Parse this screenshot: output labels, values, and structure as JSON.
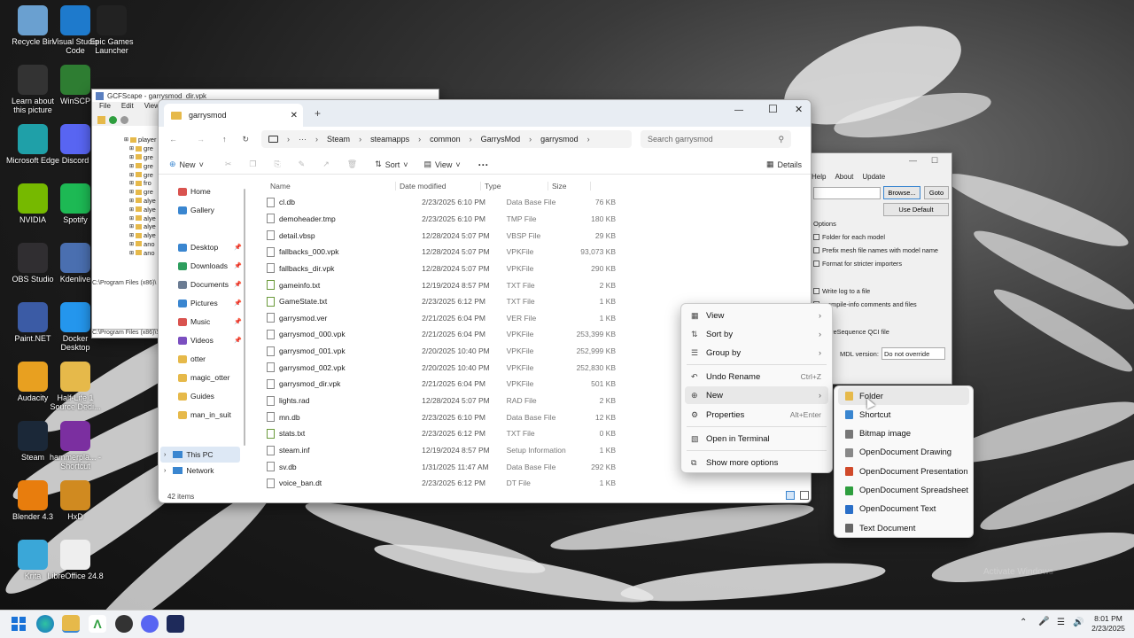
{
  "desktop_icons": [
    {
      "label": "Recycle Bin",
      "icon": "recycle-bin-icon",
      "color": "#6aa0d0"
    },
    {
      "label": "Visual Studio Code",
      "icon": "vscode-icon",
      "color": "#1e7acc"
    },
    {
      "label": "Epic Games Launcher",
      "icon": "epic-games-icon",
      "color": "#222"
    },
    {
      "label": "Learn about this picture",
      "icon": "learn-picture-icon",
      "color": "#333"
    },
    {
      "label": "WinSCP",
      "icon": "winscp-icon",
      "color": "#2e7d32"
    },
    {
      "label": "Microsoft Edge",
      "icon": "edge-icon",
      "color": "#1fa0a8"
    },
    {
      "label": "Discord",
      "icon": "discord-icon",
      "color": "#5865f2"
    },
    {
      "label": "NVIDIA",
      "icon": "nvidia-icon",
      "color": "#76b900"
    },
    {
      "label": "Spotify",
      "icon": "spotify-icon",
      "color": "#1db954"
    },
    {
      "label": "OBS Studio",
      "icon": "obs-icon",
      "color": "#302e31"
    },
    {
      "label": "Kdenlive",
      "icon": "kdenlive-icon",
      "color": "#4a6fb0"
    },
    {
      "label": "Paint.NET",
      "icon": "paintnet-icon",
      "color": "#3b5ba5"
    },
    {
      "label": "Docker Desktop",
      "icon": "docker-icon",
      "color": "#2496ed"
    },
    {
      "label": "Audacity",
      "icon": "audacity-icon",
      "color": "#e8a020"
    },
    {
      "label": "Half-Life 1 Source Dedi...",
      "icon": "folder-icon",
      "color": "#e6b94a"
    },
    {
      "label": "Steam",
      "icon": "steam-icon",
      "color": "#1b2838"
    },
    {
      "label": "hammerpla... - Shortcut",
      "icon": "hammer-icon",
      "color": "#7b2fa0"
    },
    {
      "label": "Blender 4.3",
      "icon": "blender-icon",
      "color": "#e87d0d"
    },
    {
      "label": "HxD",
      "icon": "hxd-icon",
      "color": "#d08a20"
    },
    {
      "label": "Krita",
      "icon": "krita-icon",
      "color": "#3aa7d8"
    },
    {
      "label": "LibreOffice 24.8",
      "icon": "libreoffice-icon",
      "color": "#eee"
    }
  ],
  "gcfscape": {
    "title": "GCFScape - garrysmod_dir.vpk",
    "menus": [
      "File",
      "Edit",
      "View"
    ],
    "tree": [
      "player",
      "gre",
      "gre",
      "gre",
      "gre",
      "fro",
      "gre",
      "alye",
      "alye",
      "alye",
      "alye",
      "alye",
      "ano",
      "ano"
    ],
    "status1": "C:\\Program Files (x86)\\",
    "status2": "C:\\Program Files (x86)\\S"
  },
  "crowbar": {
    "menus": [
      "Help",
      "About",
      "Update"
    ],
    "browse": "Browse...",
    "goto": "Goto",
    "use_default": "Use Default",
    "options_title": "Options",
    "checks": [
      "Folder for each model",
      "Prefix mesh file names with model name",
      "Format for stricter importers",
      "Write log to a file",
      "...ompile-info comments and files",
      "...areSequence QCI file"
    ],
    "mdl_label": "MDL version:",
    "mdl_value": "Do not override"
  },
  "explorer": {
    "tab_title": "garrysmod",
    "breadcrumb": [
      "Steam",
      "steamapps",
      "common",
      "GarrysMod",
      "garrysmod"
    ],
    "search_placeholder": "Search garrysmod",
    "toolbar": {
      "new": "New",
      "sort": "Sort",
      "view": "View",
      "more": "···",
      "details": "Details"
    },
    "nav": [
      {
        "label": "Home",
        "icon": "home-icon",
        "color": "#d9534f"
      },
      {
        "label": "Gallery",
        "icon": "gallery-icon",
        "color": "#3a86d0"
      },
      {
        "label": "Desktop",
        "icon": "desktop-icon",
        "color": "#3a86d0",
        "pin": true
      },
      {
        "label": "Downloads",
        "icon": "downloads-icon",
        "color": "#2e9e5e",
        "pin": true
      },
      {
        "label": "Documents",
        "icon": "documents-icon",
        "color": "#6b7c93",
        "pin": true
      },
      {
        "label": "Pictures",
        "icon": "pictures-icon",
        "color": "#3a86d0",
        "pin": true
      },
      {
        "label": "Music",
        "icon": "music-icon",
        "color": "#d9534f",
        "pin": true
      },
      {
        "label": "Videos",
        "icon": "videos-icon",
        "color": "#7b4fc0",
        "pin": true
      },
      {
        "label": "otter",
        "icon": "folder-icon",
        "color": "#e6b94a"
      },
      {
        "label": "magic_otter",
        "icon": "folder-icon",
        "color": "#e6b94a"
      },
      {
        "label": "Guides",
        "icon": "folder-icon",
        "color": "#e6b94a"
      },
      {
        "label": "man_in_suit",
        "icon": "folder-icon",
        "color": "#e6b94a"
      }
    ],
    "this_pc": "This PC",
    "network": "Network",
    "columns": [
      "Name",
      "Date modified",
      "Type",
      "Size"
    ],
    "files": [
      [
        "cl.db",
        "2/23/2025 6:10 PM",
        "Data Base File",
        "76 KB"
      ],
      [
        "demoheader.tmp",
        "2/23/2025 6:10 PM",
        "TMP File",
        "180 KB"
      ],
      [
        "detail.vbsp",
        "12/28/2024 5:07 PM",
        "VBSP File",
        "29 KB"
      ],
      [
        "fallbacks_000.vpk",
        "12/28/2024 5:07 PM",
        "VPKFile",
        "93,073 KB"
      ],
      [
        "fallbacks_dir.vpk",
        "12/28/2024 5:07 PM",
        "VPKFile",
        "290 KB"
      ],
      [
        "gameinfo.txt",
        "12/19/2024 8:57 PM",
        "TXT File",
        "2 KB"
      ],
      [
        "GameState.txt",
        "2/23/2025 6:12 PM",
        "TXT File",
        "1 KB"
      ],
      [
        "garrysmod.ver",
        "2/21/2025 6:04 PM",
        "VER File",
        "1 KB"
      ],
      [
        "garrysmod_000.vpk",
        "2/21/2025 6:04 PM",
        "VPKFile",
        "253,399 KB"
      ],
      [
        "garrysmod_001.vpk",
        "2/20/2025 10:40 PM",
        "VPKFile",
        "252,999 KB"
      ],
      [
        "garrysmod_002.vpk",
        "2/20/2025 10:40 PM",
        "VPKFile",
        "252,830 KB"
      ],
      [
        "garrysmod_dir.vpk",
        "2/21/2025 6:04 PM",
        "VPKFile",
        "501 KB"
      ],
      [
        "lights.rad",
        "12/28/2024 5:07 PM",
        "RAD File",
        "2 KB"
      ],
      [
        "mn.db",
        "2/23/2025 6:10 PM",
        "Data Base File",
        "12 KB"
      ],
      [
        "stats.txt",
        "2/23/2025 6:12 PM",
        "TXT File",
        "0 KB"
      ],
      [
        "steam.inf",
        "12/19/2024 8:57 PM",
        "Setup Information",
        "1 KB"
      ],
      [
        "sv.db",
        "1/31/2025 11:47 AM",
        "Data Base File",
        "292 KB"
      ],
      [
        "voice_ban.dt",
        "2/23/2025 6:12 PM",
        "DT File",
        "1 KB"
      ]
    ],
    "status": "42 items"
  },
  "context_menu": [
    {
      "label": "View",
      "icon": "view-icon",
      "submenu": true
    },
    {
      "label": "Sort by",
      "icon": "sort-icon",
      "submenu": true
    },
    {
      "label": "Group by",
      "icon": "group-icon",
      "submenu": true
    },
    {
      "label": "Undo Rename",
      "icon": "undo-icon",
      "shortcut": "Ctrl+Z"
    },
    {
      "label": "New",
      "icon": "new-icon",
      "submenu": true
    },
    {
      "label": "Properties",
      "icon": "properties-icon",
      "shortcut": "Alt+Enter"
    },
    {
      "label": "Open in Terminal",
      "icon": "terminal-icon"
    },
    {
      "label": "Show more options",
      "icon": "more-options-icon"
    }
  ],
  "submenu": [
    {
      "label": "Folder",
      "icon": "folder-icon",
      "color": "#e6b94a"
    },
    {
      "label": "Shortcut",
      "icon": "shortcut-icon",
      "color": "#3a86d0"
    },
    {
      "label": "Bitmap image",
      "icon": "bitmap-icon",
      "color": "#777"
    },
    {
      "label": "OpenDocument Drawing",
      "icon": "odg-icon",
      "color": "#888"
    },
    {
      "label": "OpenDocument Presentation",
      "icon": "odp-icon",
      "color": "#d04a2a"
    },
    {
      "label": "OpenDocument Spreadsheet",
      "icon": "ods-icon",
      "color": "#2e9e3e"
    },
    {
      "label": "OpenDocument Text",
      "icon": "odt-icon",
      "color": "#2a6fc8"
    },
    {
      "label": "Text Document",
      "icon": "text-doc-icon",
      "color": "#666"
    }
  ],
  "taskbar": {
    "time": "8:01 PM",
    "date": "2/23/2025"
  },
  "watermark": "Activate Windows"
}
